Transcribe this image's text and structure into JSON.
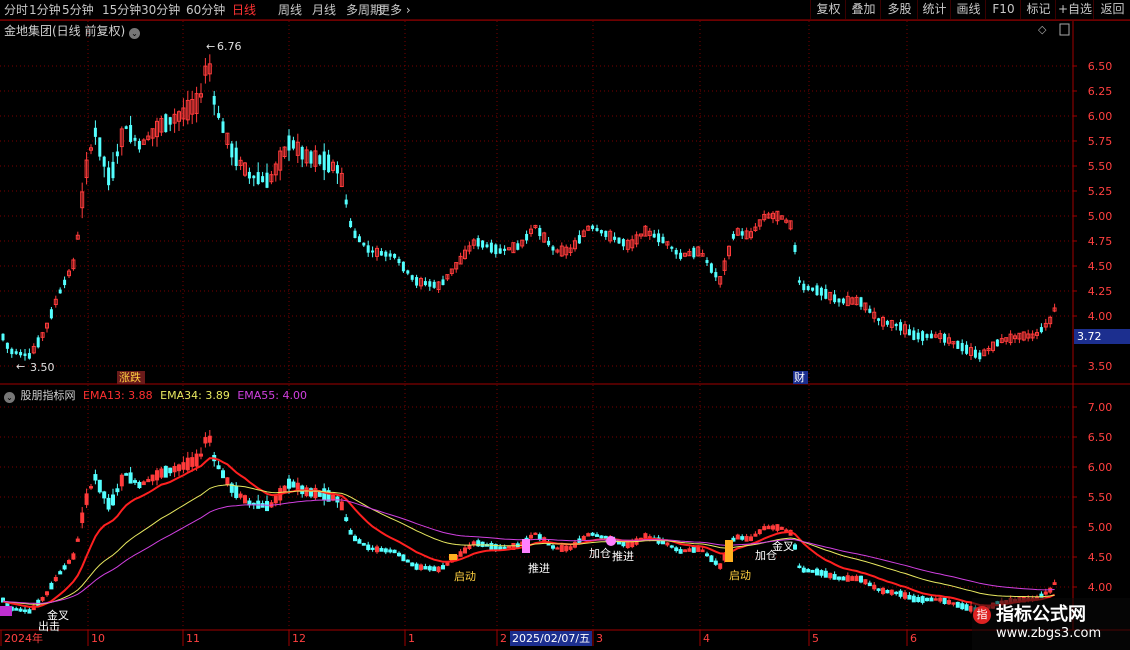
{
  "toolbar": {
    "periods": [
      "分时",
      "1分钟",
      "5分钟",
      "15分钟",
      "30分钟",
      "60分钟",
      "日线",
      "周线",
      "月线",
      "多周期",
      "更多"
    ],
    "active_period": "日线",
    "right_buttons": [
      "复权",
      "叠加",
      "多股",
      "统计",
      "画线",
      "F10",
      "标记",
      "+自选",
      "返回"
    ]
  },
  "main": {
    "title": "金地集团(日线 前复权)",
    "axis_labels": [
      "6.50",
      "6.25",
      "6.00",
      "5.75",
      "5.50",
      "5.25",
      "5.00",
      "4.75",
      "4.50",
      "4.25",
      "4.00",
      "3.50"
    ],
    "current_price": "3.72",
    "high_label": "6.76",
    "low_label": "3.50",
    "flag_left": "涨跌",
    "flag_right": "财"
  },
  "indicator": {
    "name": "股朋指标网",
    "ema13": "EMA13: 3.88",
    "ema34": "EMA34: 3.89",
    "ema55": "EMA55: 4.00",
    "axis_labels": [
      "7.00",
      "6.50",
      "6.00",
      "5.50",
      "5.00",
      "4.50",
      "4.00"
    ],
    "signals": [
      "启动",
      "推进",
      "加仓",
      "推进",
      "启动",
      "加仓",
      "金叉",
      "金叉",
      "出击"
    ]
  },
  "x_axis": {
    "labels": [
      "2024年",
      "10",
      "11",
      "12",
      "1",
      "2",
      "3",
      "4",
      "5",
      "6"
    ],
    "cursor_date": "2025/02/07/五"
  },
  "watermark": {
    "title": "指标公式网",
    "url": "www.zbgs3.com"
  },
  "colors": {
    "up": "#ff3b3b",
    "down": "#54ffff",
    "ema13": "#ff2020",
    "ema34": "#e8e860",
    "ema55": "#d040e0",
    "grid": "#7a0000"
  }
}
